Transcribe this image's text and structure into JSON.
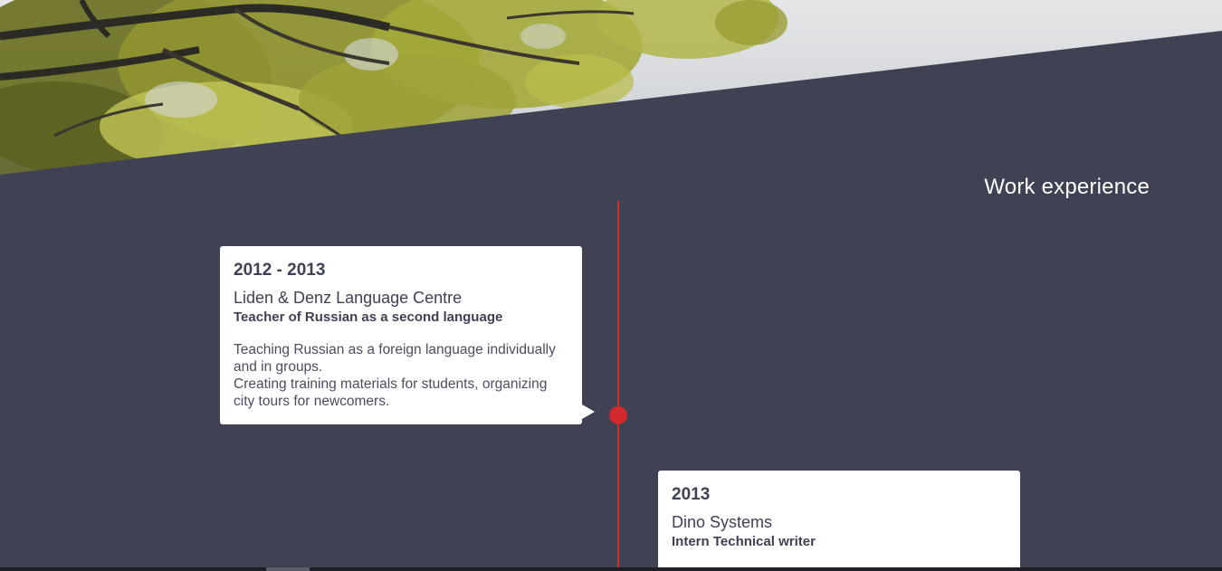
{
  "section": {
    "title": "Work experience"
  },
  "timeline": {
    "accent_color": "#d3292c",
    "background_color": "#3e4253",
    "entries": [
      {
        "period": "2012 - 2013",
        "company": "Liden & Denz Language Centre",
        "role": "Teacher of Russian as a second language",
        "description": [
          "Teaching Russian as a foreign language individually and in groups.",
          "Creating training materials for students, organizing city tours for newcomers."
        ]
      },
      {
        "period": "2013",
        "company": "Dino Systems",
        "role": "Intern Technical writer"
      }
    ]
  },
  "hero": {
    "image_icon": "tree-foliage-photo"
  }
}
